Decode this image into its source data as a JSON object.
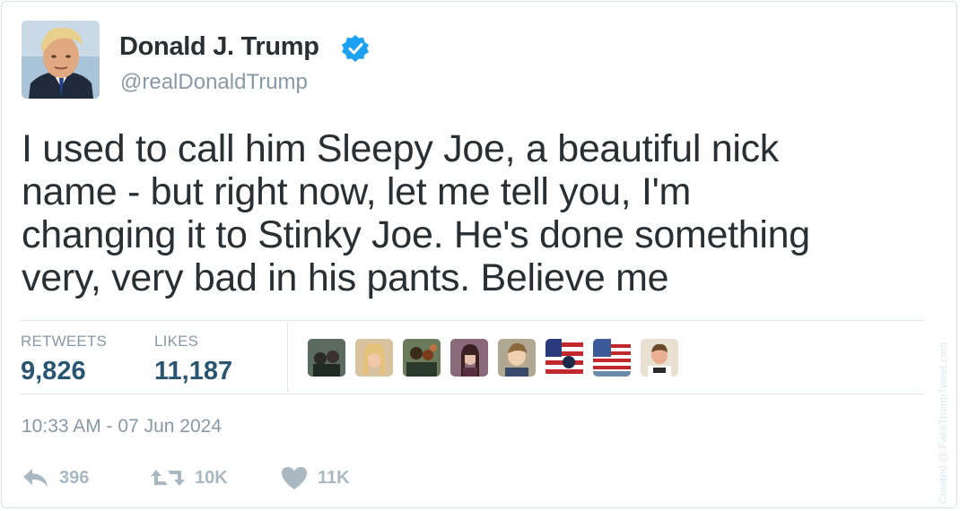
{
  "author": {
    "display_name": "Donald J. Trump",
    "handle": "@realDonaldTrump",
    "verified_icon": "verified-badge-icon",
    "avatar_icon": "profile-photo"
  },
  "tweet": {
    "lines": [
      "I used to call him Sleepy Joe, a beautiful nick",
      "name - but right now, let me tell you, I'm",
      "changing it to Stinky Joe. He's done something",
      "very, very bad in his pants. Believe me"
    ]
  },
  "stats": {
    "retweets_label": "RETWEETS",
    "retweets_value": "9,826",
    "likes_label": "LIKES",
    "likes_value": "11,187"
  },
  "liked_by_avatars": [
    "avatar-1",
    "avatar-2",
    "avatar-3",
    "avatar-4",
    "avatar-5",
    "avatar-6",
    "avatar-7",
    "avatar-8"
  ],
  "timestamp": "10:33 AM - 07 Jun 2024",
  "actions": {
    "reply_icon": "reply-icon",
    "reply_count": "396",
    "retweet_icon": "retweet-icon",
    "retweet_count": "10K",
    "like_icon": "heart-icon",
    "like_count": "11K"
  },
  "watermark": "Created @ FakeTrumpTweet.com",
  "colors": {
    "text": "#292f33",
    "muted": "#8899a6",
    "stat_value": "#2a5570",
    "verified": "#1da1f2",
    "divider": "#e1e8ed",
    "action": "#aab8c2"
  }
}
